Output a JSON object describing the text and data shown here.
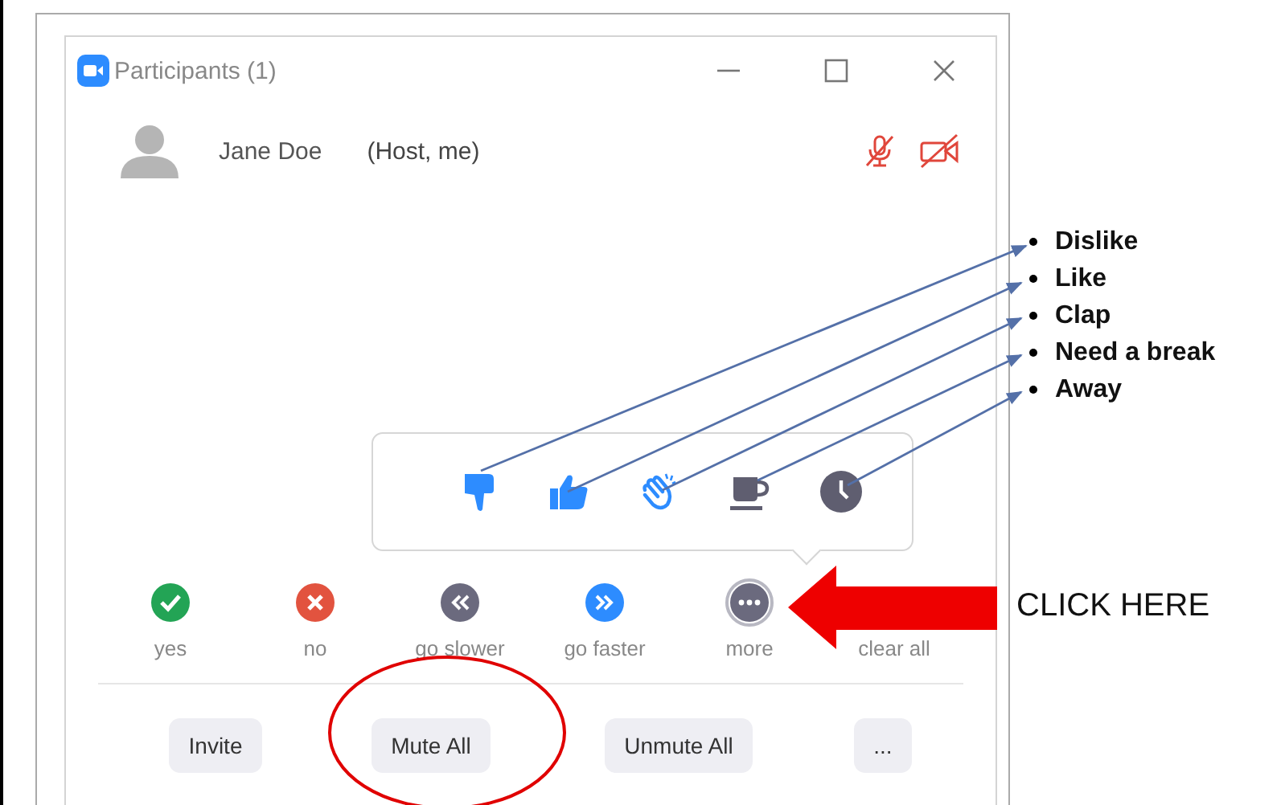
{
  "window": {
    "title": "Participants (1)"
  },
  "participants": [
    {
      "name": "Jane Doe",
      "role": "(Host, me)",
      "muted": true,
      "video_off": true
    }
  ],
  "reactions": [
    {
      "kind": "dislike"
    },
    {
      "kind": "like"
    },
    {
      "kind": "clap"
    },
    {
      "kind": "break"
    },
    {
      "kind": "away"
    }
  ],
  "feedback": [
    {
      "label": "yes",
      "kind": "yes",
      "selected": false
    },
    {
      "label": "no",
      "kind": "no",
      "selected": false
    },
    {
      "label": "go slower",
      "kind": "slower",
      "selected": false
    },
    {
      "label": "go faster",
      "kind": "faster",
      "selected": false
    },
    {
      "label": "more",
      "kind": "more",
      "selected": true
    },
    {
      "label": "clear all",
      "kind": "clear",
      "selected": false
    }
  ],
  "buttons": [
    "Invite",
    "Mute All",
    "Unmute All",
    "..."
  ],
  "annotations": {
    "labels": [
      "Dislike",
      "Like",
      "Clap",
      "Need a break",
      "Away"
    ],
    "callout": "CLICK HERE"
  }
}
